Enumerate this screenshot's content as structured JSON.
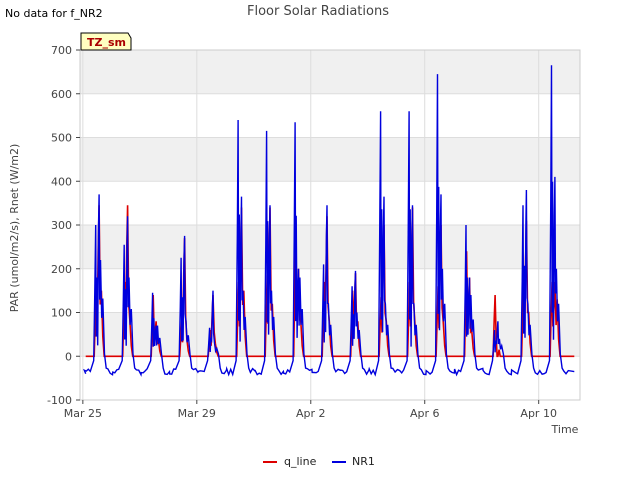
{
  "header": {
    "no_data_text": "No data for f_NR2"
  },
  "badge": {
    "text": "TZ_sm"
  },
  "colors": {
    "q_line": "#dd0000",
    "NR1": "#0000dd",
    "band": "#f0f0f0",
    "grid": "#dddddd"
  },
  "chart_data": {
    "type": "line",
    "title": "Floor Solar Radiations",
    "xlabel": "Time",
    "ylabel": "PAR (umol/m2/s), Rnet (W/m2)",
    "xlim": [
      -0.1,
      17.45
    ],
    "ylim": [
      -100,
      700
    ],
    "yticks": [
      -100,
      0,
      100,
      200,
      300,
      400,
      500,
      600,
      700
    ],
    "xticks": [
      {
        "day": 0,
        "label": "Mar 25"
      },
      {
        "day": 4,
        "label": "Mar 29"
      },
      {
        "day": 8,
        "label": "Apr 2"
      },
      {
        "day": 12,
        "label": "Apr 6"
      },
      {
        "day": 16,
        "label": "Apr 10"
      }
    ],
    "grid": true,
    "legend_position": "bottom-center",
    "series": [
      {
        "name": "q_line",
        "color": "#dd0000",
        "daily_peaks": [
          [
            165,
            345,
            150
          ],
          [
            170,
            345,
            80
          ],
          [
            140,
            80,
            40
          ],
          [
            80,
            270,
            40
          ],
          [
            60,
            140,
            30
          ],
          [
            170,
            340,
            150
          ],
          [
            185,
            340,
            120
          ],
          [
            270,
            200,
            80
          ],
          [
            170,
            320,
            80
          ],
          [
            150,
            190,
            80
          ],
          [
            135,
            300,
            80
          ],
          [
            170,
            340,
            80
          ],
          [
            160,
            300,
            80
          ],
          [
            240,
            180,
            60
          ],
          [
            140,
            0,
            0
          ],
          [
            165,
            310,
            100
          ],
          [
            170,
            170,
            130
          ]
        ]
      },
      {
        "name": "NR1",
        "color": "#0000dd",
        "night_value": -35,
        "daily_peaks": [
          [
            300,
            370,
            220
          ],
          [
            255,
            320,
            180
          ],
          [
            145,
            70,
            70
          ],
          [
            225,
            275,
            80
          ],
          [
            65,
            150,
            30
          ],
          [
            540,
            365,
            150
          ],
          [
            515,
            345,
            150
          ],
          [
            535,
            200,
            180
          ],
          [
            210,
            345,
            120
          ],
          [
            160,
            195,
            100
          ],
          [
            560,
            365,
            120
          ],
          [
            560,
            345,
            120
          ],
          [
            645,
            370,
            200
          ],
          [
            300,
            180,
            140
          ],
          [
            60,
            80,
            40
          ],
          [
            345,
            380,
            120
          ],
          [
            665,
            410,
            200
          ]
        ]
      }
    ]
  }
}
